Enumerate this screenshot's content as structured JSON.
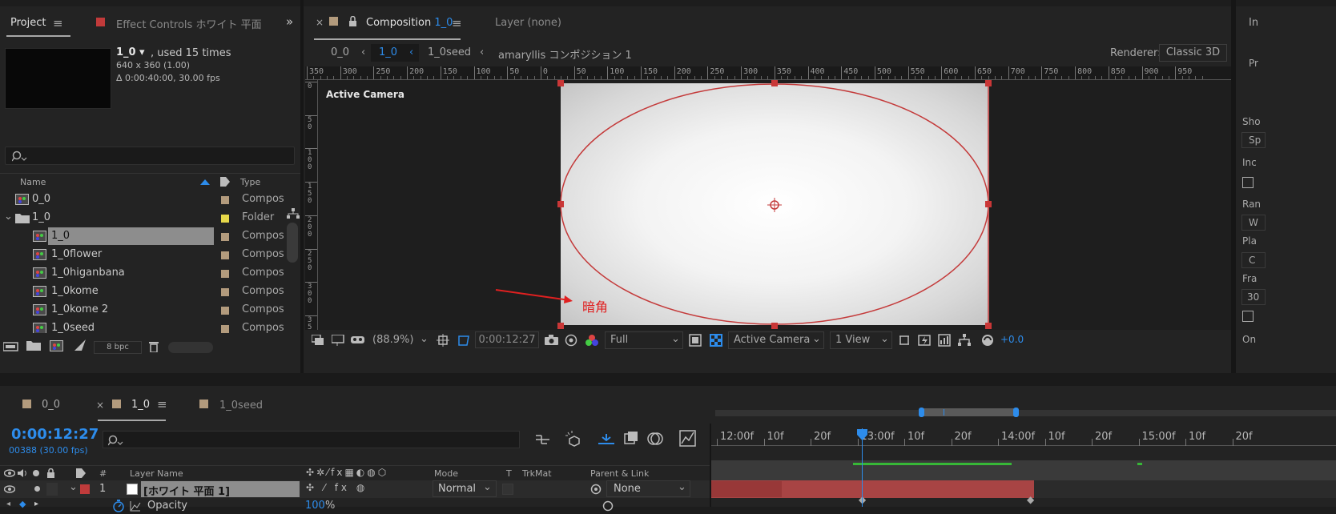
{
  "project": {
    "tab_active": "Project",
    "tab_effect": "Effect Controls ホワイト 平面",
    "item_name": "1_0",
    "used_times": ", used 15 times",
    "dims": "640 x 360 (1.00)",
    "duration": "Δ 0:00:40:00, 30.00 fps",
    "col_name": "Name",
    "col_type": "Type",
    "bpc": "8 bpc",
    "rows": [
      {
        "name": "0_0",
        "type": "Compos",
        "color": "#b39b7d"
      },
      {
        "name": "1_0",
        "type": "Folder",
        "color": "#e6d84a"
      },
      {
        "name": "1_0",
        "type": "Compos",
        "color": "#b39b7d"
      },
      {
        "name": "1_0flower",
        "type": "Compos",
        "color": "#b39b7d"
      },
      {
        "name": "1_0higanbana",
        "type": "Compos",
        "color": "#b39b7d"
      },
      {
        "name": "1_0kome",
        "type": "Compos",
        "color": "#b39b7d"
      },
      {
        "name": "1_0kome 2",
        "type": "Compos",
        "color": "#b39b7d"
      },
      {
        "name": "1_0seed",
        "type": "Compos",
        "color": "#b39b7d"
      }
    ]
  },
  "composition": {
    "tab_prefix": "Composition",
    "tab_name": "1_0",
    "layer_tab": "Layer  (none)",
    "breadcrumb": [
      "0_0",
      "1_0",
      "1_0seed",
      "amaryllis コンポジション 1"
    ],
    "renderer_label": "Renderer:",
    "renderer_value": "Classic 3D",
    "active_camera_label": "Active Camera",
    "annotation": "暗角",
    "ruler_labels": [
      "350",
      "300",
      "250",
      "200",
      "150",
      "100",
      "50",
      "0",
      "50",
      "100",
      "150",
      "200",
      "250",
      "300",
      "350",
      "400",
      "450",
      "500",
      "550",
      "600",
      "650",
      "700",
      "750",
      "800",
      "850",
      "900",
      "950"
    ],
    "vruler_labels": [
      "0",
      "50",
      "100",
      "150",
      "200",
      "250",
      "300",
      "350"
    ],
    "zoom": "(88.9%)",
    "timecode": "0:00:12:27",
    "resolution": "Full",
    "view_camera": "Active Camera",
    "view_count": "1 View",
    "exposure": "+0.0"
  },
  "right_panel": {
    "labels": [
      "In",
      "Pr",
      "Sho",
      "Sp",
      "Inc",
      "Ran",
      "W",
      "Pla",
      "C",
      "Fra",
      "30",
      "On"
    ]
  },
  "timeline": {
    "tabs": [
      "0_0",
      "1_0",
      "1_0seed"
    ],
    "timecode": "0:00:12:27",
    "frames": "00388 (30.00 fps)",
    "col_num": "#",
    "col_layer_name": "Layer Name",
    "col_mode": "Mode",
    "col_t": "T",
    "col_trkmat": "TrkMat",
    "col_parent": "Parent & Link",
    "layer_num": "1",
    "layer_name": "[ホワイト 平面 1]",
    "layer_mode": "Normal",
    "layer_parent": "None",
    "prop_name": "Opacity",
    "prop_value": "100",
    "prop_unit": "%",
    "ticks": [
      "12:00f",
      "10f",
      "20f",
      "13:00f",
      "10f",
      "20f",
      "14:00f",
      "10f",
      "20f",
      "15:00f",
      "10f",
      "20f"
    ]
  },
  "colors": {
    "accent_blue": "#2d8ceb",
    "layer_red": "#c03b3b",
    "comp_tan": "#b39b7d",
    "folder_yellow": "#e6d84a",
    "annotation_red": "#e02020"
  }
}
